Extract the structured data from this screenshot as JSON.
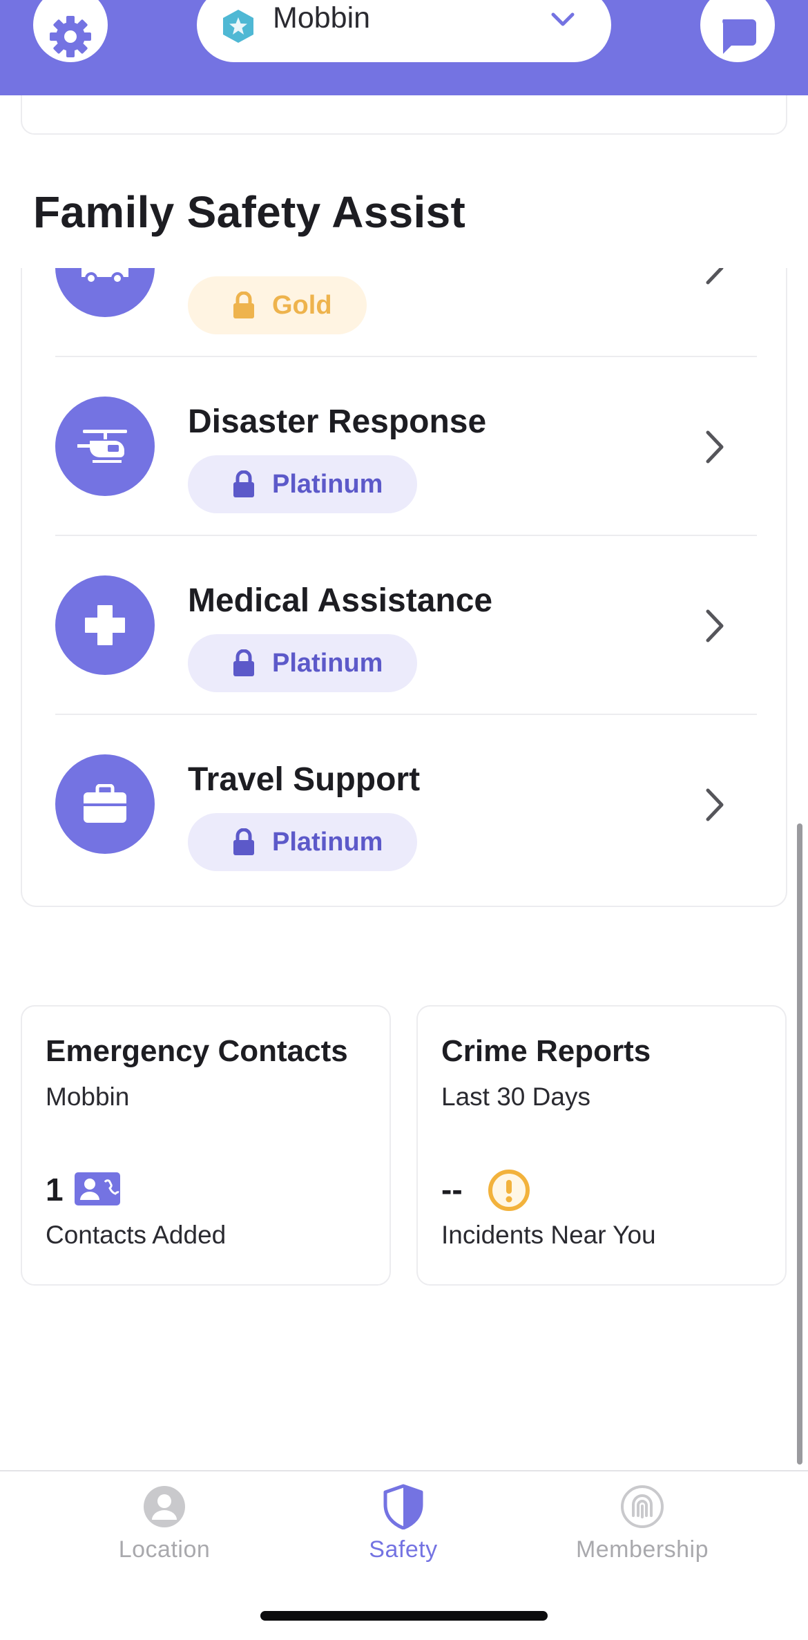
{
  "header": {
    "circle_name": "Mobbin",
    "icons": {
      "settings": "gear-icon",
      "circle": "star-icon",
      "dropdown": "chevron-down-icon",
      "chat": "chat-bubble-icon"
    }
  },
  "section": {
    "title": "Family Safety Assist",
    "features": [
      {
        "title": "",
        "tier": "Gold",
        "icon": "tow-truck-icon"
      },
      {
        "title": "Disaster Response",
        "tier": "Platinum",
        "icon": "helicopter-icon"
      },
      {
        "title": "Medical Assistance",
        "tier": "Platinum",
        "icon": "medical-cross-icon"
      },
      {
        "title": "Travel Support",
        "tier": "Platinum",
        "icon": "briefcase-icon"
      }
    ]
  },
  "cards": {
    "emergency": {
      "title": "Emergency Contacts",
      "subtitle": "Mobbin",
      "value": "1",
      "footer": "Contacts Added",
      "icon": "contact-card-icon"
    },
    "crime": {
      "title": "Crime Reports",
      "subtitle": "Last 30 Days",
      "value": "--",
      "footer": "Incidents Near You",
      "icon": "warning-icon"
    }
  },
  "tabbar": {
    "tabs": [
      {
        "label": "Location",
        "icon": "person-pin-icon",
        "active": false
      },
      {
        "label": "Safety",
        "icon": "shield-icon",
        "active": true
      },
      {
        "label": "Membership",
        "icon": "fingerprint-icon",
        "active": false
      }
    ]
  },
  "colors": {
    "brand": "#7473e2",
    "gold_badge_bg": "#fff4e2",
    "gold_text": "#eeb34d",
    "platinum_badge_bg": "#ecebfb",
    "platinum_text": "#5c59c9",
    "warning": "#f2b23c"
  }
}
